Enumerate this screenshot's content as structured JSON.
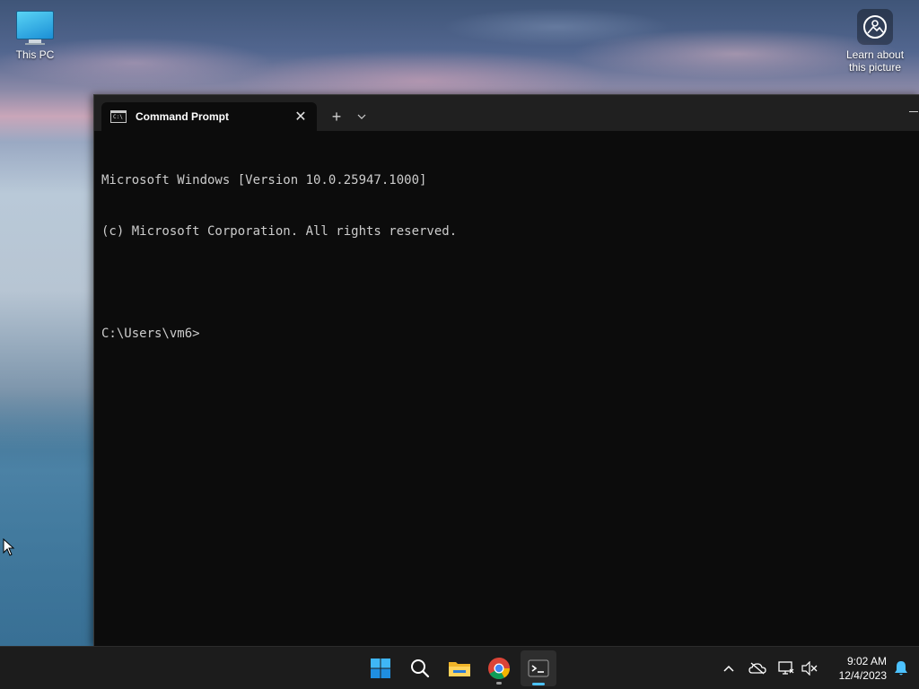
{
  "desktop": {
    "icons": [
      {
        "label": "This PC"
      },
      {
        "label_line1": "Learn about",
        "label_line2": "this picture"
      }
    ]
  },
  "window": {
    "tab_title": "Command Prompt",
    "tab_icon_text": "C:\\",
    "new_tab_glyph": "+",
    "close_glyph": "✕"
  },
  "console": {
    "lines": [
      "Microsoft Windows [Version 10.0.25947.1000]",
      "(c) Microsoft Corporation. All rights reserved.",
      "",
      "C:\\Users\\vm6>"
    ]
  },
  "taskbar": {
    "apps": [
      "start-icon",
      "search-icon",
      "file-explorer-icon",
      "chrome-icon",
      "terminal-icon"
    ],
    "tray": {
      "time": "9:02 AM",
      "date": "12/4/2023"
    }
  },
  "colors": {
    "accent": "#4cc2ff",
    "console_bg": "#0c0c0c",
    "console_fg": "#cccccc",
    "taskbar_bg": "#1c1c1c"
  }
}
